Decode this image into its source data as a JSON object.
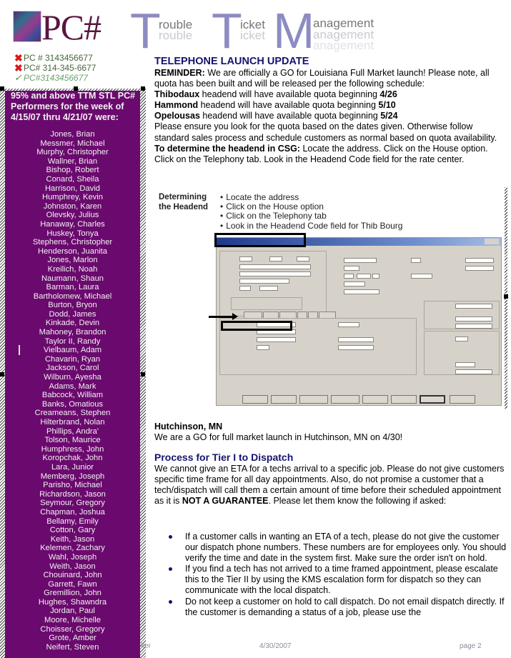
{
  "header": {
    "logo_text": "PC#",
    "ttm": [
      {
        "letter": "T",
        "word": "rouble"
      },
      {
        "letter": "T",
        "word": "icket"
      },
      {
        "letter": "M",
        "word": "anagement"
      }
    ],
    "phone_lines": [
      {
        "icon": "x-mark-icon",
        "text": "PC # 3143456677"
      },
      {
        "icon": "x-mark-icon",
        "text": "PC# 314-345-6677"
      },
      {
        "icon": "check-mark-icon",
        "text": "PC#3143456677"
      }
    ]
  },
  "sidebar": {
    "heading": "95% and above TTM STL PC# Performers for the week of 4/15/07 thru 4/21/07 were:",
    "names": [
      "Jones, Brian",
      "Messmer, Michael",
      "Murphy, Christopher",
      "Wallner, Brian",
      "Bishop, Robert",
      "Conard, Sheila",
      "Harrison, David",
      "Humphrey, Kevin",
      "Johnston, Karen",
      "Olevsky, Julius",
      "Hanaway, Charles",
      "Huskey, Tonya",
      "Stephens, Christopher",
      "Henderson, Juanita",
      "Jones, Marlon",
      "Kreilich, Noah",
      "Naumann, Shaun",
      "Barman, Laura",
      "Bartholomew, Michael",
      "Burton, Bryon",
      "Dodd, James",
      "Kinkade, Devin",
      "Mahoney, Brandon",
      "Taylor II, Randy",
      "Vielbaum, Adam",
      "Chavarin, Ryan",
      "Jackson, Carol",
      "Wilburn, Ayesha",
      "Adams, Mark",
      "Babcock, William",
      "Banks, Omatious",
      "Creameans, Stephen",
      "Hilterbrand, Nolan",
      "Phillips, Andra'",
      "Tolson, Maurice",
      "Humphress, John",
      "Koropchak, John",
      "Lara, Junior",
      "Memberg, Joseph",
      "Parisho, Michael",
      "Richardson, Jason",
      "Seymour, Gregory",
      "Chapman, Joshua",
      "Bellamy, Emily",
      "Cotton, Gary",
      "Keith, Jason",
      "Kelemen, Zachary",
      "Wahl, Joseph",
      "Weith, Jason",
      "Chouinard, John",
      "Garrett, Fawn",
      "Gremillion, John",
      "Hughes, Shawndra",
      "Jordan, Paul",
      "Moore, Michelle",
      "Choisser, Gregory",
      "Grote, Amber",
      "Neifert, Steven"
    ]
  },
  "telephone": {
    "title": "TELEPHONE LAUNCH UPDATE",
    "reminder_label": "REMINDER:",
    "reminder_text": " We are officially a GO for Louisiana Full Market launch! Please note, all quota has been built and will be released per the following schedule:",
    "schedule": [
      {
        "headend": "Thibodaux",
        "text": " headend will have available quota beginning ",
        "date": "4/26"
      },
      {
        "headend": "Hammond",
        "text": " headend will have available quota beginning ",
        "date": "5/10"
      },
      {
        "headend": "Opelousas",
        "text": " headend will have available quota beginning ",
        "date": "5/24"
      }
    ],
    "para1": "Please ensure you look for the quota based on the dates given. Otherwise follow standard sales process and schedule customers as normal based on quota availability. ",
    "para_bold": "To determine the headend in CSG:",
    "para2": " Locate the address. Click on the House option. Click on the Telephony tab. Look in the Headend Code field for the rate center."
  },
  "screenshot": {
    "label_line1": "Determining",
    "label_line2": "the Headend",
    "steps": [
      "Locate the address",
      "Click on the House option",
      "Click on the Telephony tab",
      "Look in the Headend Code field for Thib Bourg"
    ]
  },
  "hutchinson": {
    "title": "Hutchinson, MN",
    "text": "We are a GO for full market launch in Hutchinson, MN on 4/30!"
  },
  "dispatch": {
    "title": "Process for Tier I to Dispatch",
    "intro1": "We cannot give an ETA for a techs arrival to a specific job.  Please do not give customers specific time frame for all day appointments.  Also, do not promise a customer that a tech/dispatch will call them a certain amount of time before their scheduled appointment as it is ",
    "intro_bold": "NOT A GUARANTEE",
    "intro2": ".  Please let them know the following if asked:",
    "bullets": [
      "If a customer calls in wanting an ETA of a tech, please do not give the customer our dispatch phone numbers.  These numbers are for employees only.  You should verify the time and date in the system first.  Make sure the order isn't on hold.",
      "If you find a tech has not arrived to a time framed appointment, please escalate this to the Tier II by using the KMS escalation form for dispatch so they can communicate with the local dispatch.",
      "Do not keep a customer on hold to call dispatch.  Do not email dispatch directly.  If the customer is demanding a status of a job, please use the"
    ]
  },
  "footer": {
    "left": "ker",
    "date": "4/30/2007",
    "page": "page 2"
  }
}
